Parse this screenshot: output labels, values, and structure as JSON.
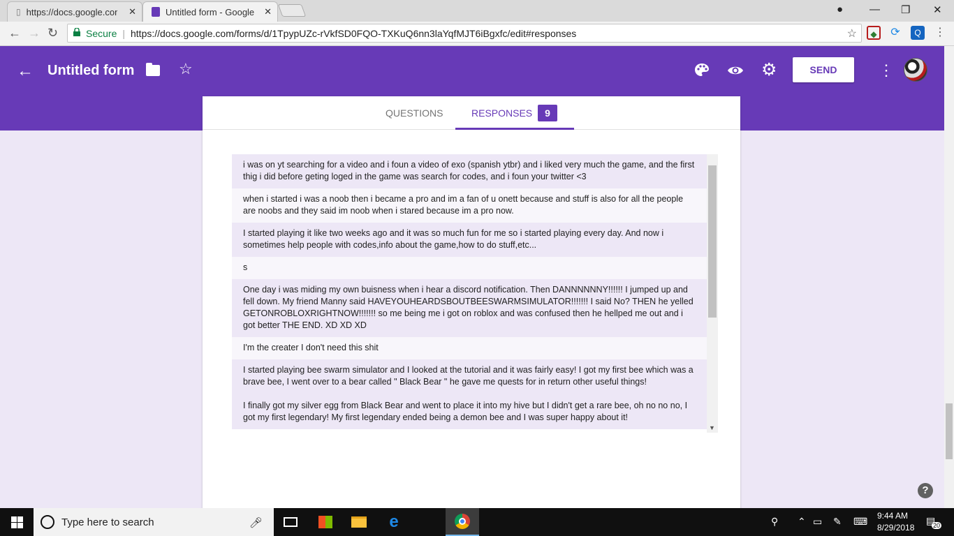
{
  "browser": {
    "tabs": [
      {
        "title": "https://docs.google.com/",
        "close": "✕"
      },
      {
        "title": "Untitled form - Google Fo",
        "close": "✕"
      }
    ],
    "secure_label": "Secure",
    "url": "https://docs.google.com/forms/d/1TpypUZc-rVkfSD0FQO-TXKuQ6nn3laYqfMJT6iBgxfc/edit#responses"
  },
  "header": {
    "title": "Untitled form",
    "send_label": "SEND",
    "color": "#673ab7"
  },
  "tabs": {
    "questions": "QUESTIONS",
    "responses": "RESPONSES",
    "responses_count": "9"
  },
  "responses": [
    {
      "text": [
        "i was on yt searching for a video and i foun a video of exo (spanish ytbr) and i liked very much the game, and the first thig i did before geting loged in the game was search for codes, and i foun your twitter <3"
      ]
    },
    {
      "text": [
        "when i started i was a noob then i became a pro and im a fan of u onett because and stuff is also for all the people are noobs and they said im noob when i stared because im a pro now."
      ]
    },
    {
      "text": [
        "I started playing it like two weeks ago and it was so much fun for me so i started playing every day. And now i sometimes help people with codes,info about the game,how to do stuff,etc..."
      ]
    },
    {
      "text": [
        "s"
      ]
    },
    {
      "text": [
        "One day i was miding my own buisness when i hear a discord notification. Then DANNNNNNY!!!!!! I jumped up and fell down. My friend Manny said HAVEYOUHEARDSBOUTBEESWARMSIMULATOR!!!!!!! I said No? THEN he yelled GETONROBLOXRIGHTNOW!!!!!!! so me being me i got on roblox and was confused then he hellped me out and i got better THE END. XD XD XD"
      ]
    },
    {
      "text": [
        "I'm the creater I don't need this shit"
      ]
    },
    {
      "text": [
        "I started playing bee swarm simulator and I looked at the tutorial and it was fairly easy! I got my first bee which was a brave bee, I went over to a bear called \" Black Bear \" he gave me quests for in return other useful things!",
        "I finally got my silver egg from Black Bear and went to place it into my hive but I didn't get a rare bee, oh no no no, I got my first legendary! My first legendary ended being a demon bee and I was super happy about it!"
      ]
    }
  ],
  "taskbar": {
    "search_placeholder": "Type here to search",
    "time": "9:44 AM",
    "date": "8/29/2018",
    "notifications": "20"
  }
}
